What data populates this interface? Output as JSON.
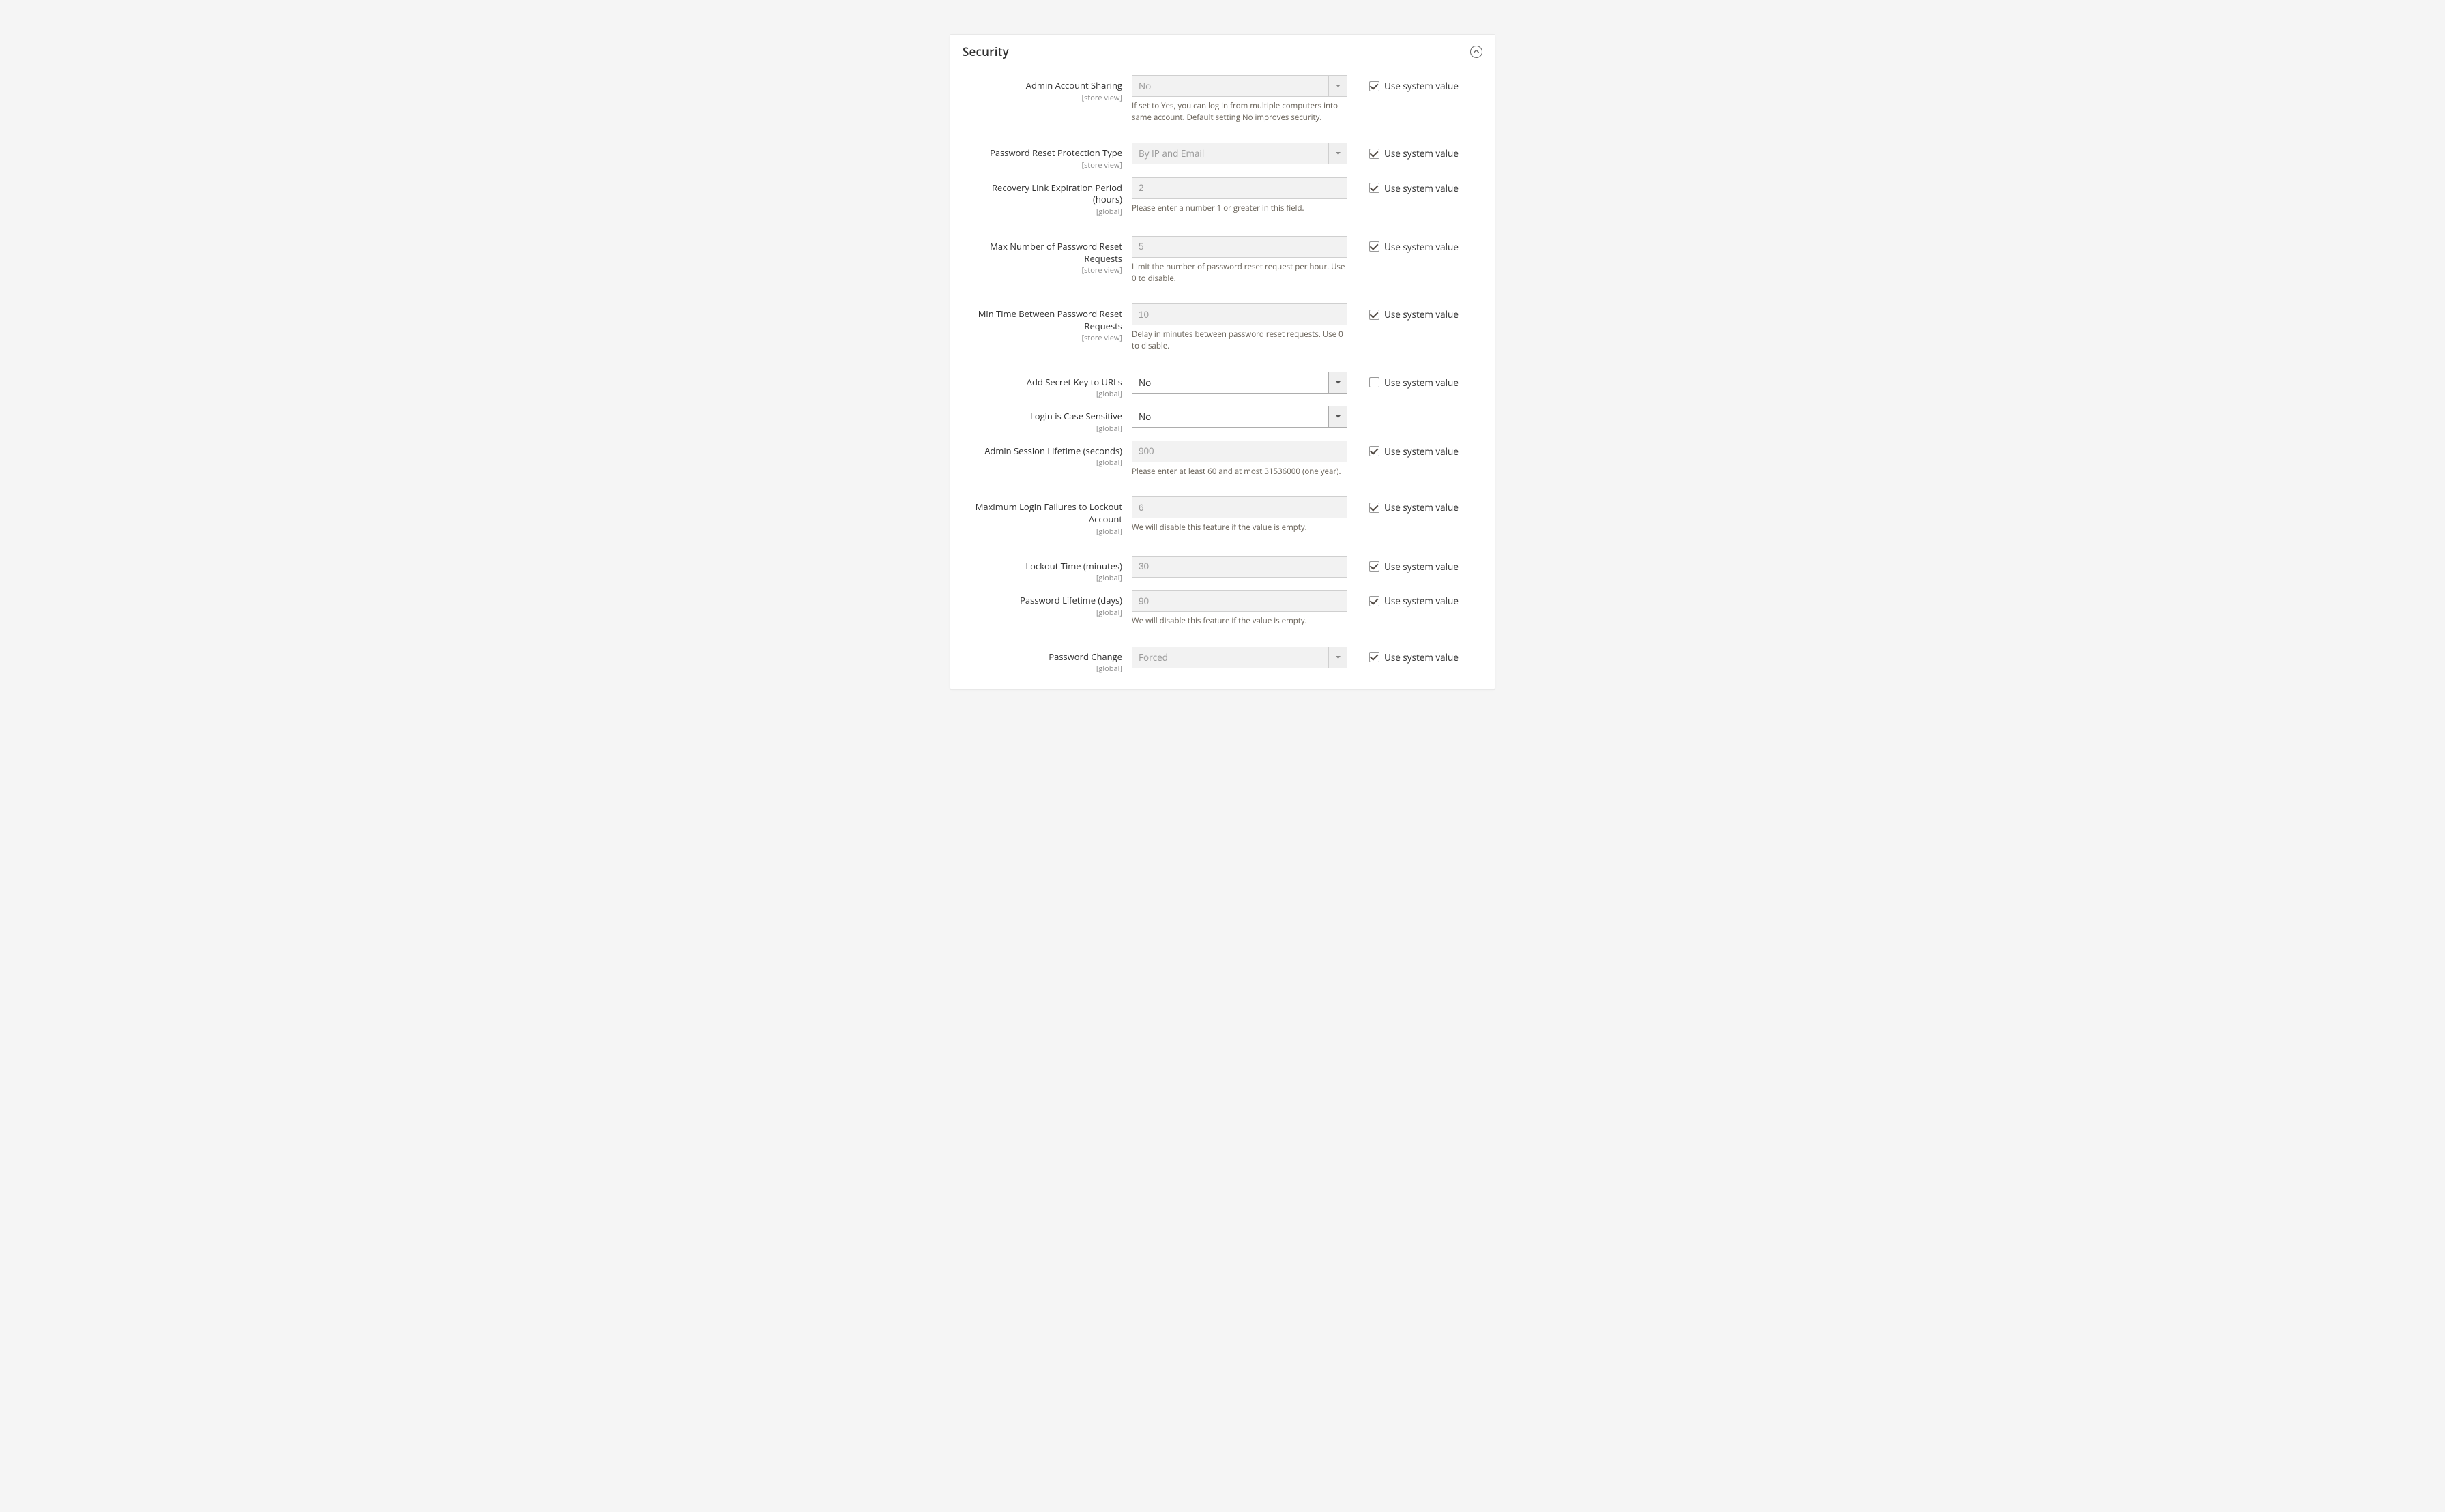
{
  "panel": {
    "title": "Security",
    "use_system_label": "Use system value"
  },
  "scopes": {
    "store_view": "[store view]",
    "global": "[global]"
  },
  "fields": {
    "admin_account_sharing": {
      "label": "Admin Account Sharing",
      "value": "No",
      "note": "If set to Yes, you can log in from multiple computers into same account. Default setting No improves security."
    },
    "password_reset_protection_type": {
      "label": "Password Reset Protection Type",
      "value": "By IP and Email"
    },
    "recovery_link_expiration": {
      "label": "Recovery Link Expiration Period (hours)",
      "value": "2",
      "note": "Please enter a number 1 or greater in this field."
    },
    "max_reset_requests": {
      "label": "Max Number of Password Reset Requests",
      "value": "5",
      "note": "Limit the number of password reset request per hour. Use 0 to disable."
    },
    "min_time_between_reset": {
      "label": "Min Time Between Password Reset Requests",
      "value": "10",
      "note": "Delay in minutes between password reset requests. Use 0 to disable."
    },
    "add_secret_key": {
      "label": "Add Secret Key to URLs",
      "value": "No"
    },
    "login_case_sensitive": {
      "label": "Login is Case Sensitive",
      "value": "No"
    },
    "session_lifetime": {
      "label": "Admin Session Lifetime (seconds)",
      "value": "900",
      "note": "Please enter at least 60 and at most 31536000 (one year)."
    },
    "max_login_failures": {
      "label": "Maximum Login Failures to Lockout Account",
      "value": "6",
      "note": "We will disable this feature if the value is empty."
    },
    "lockout_time": {
      "label": "Lockout Time (minutes)",
      "value": "30"
    },
    "password_lifetime": {
      "label": "Password Lifetime (days)",
      "value": "90",
      "note": "We will disable this feature if the value is empty."
    },
    "password_change": {
      "label": "Password Change",
      "value": "Forced"
    }
  }
}
